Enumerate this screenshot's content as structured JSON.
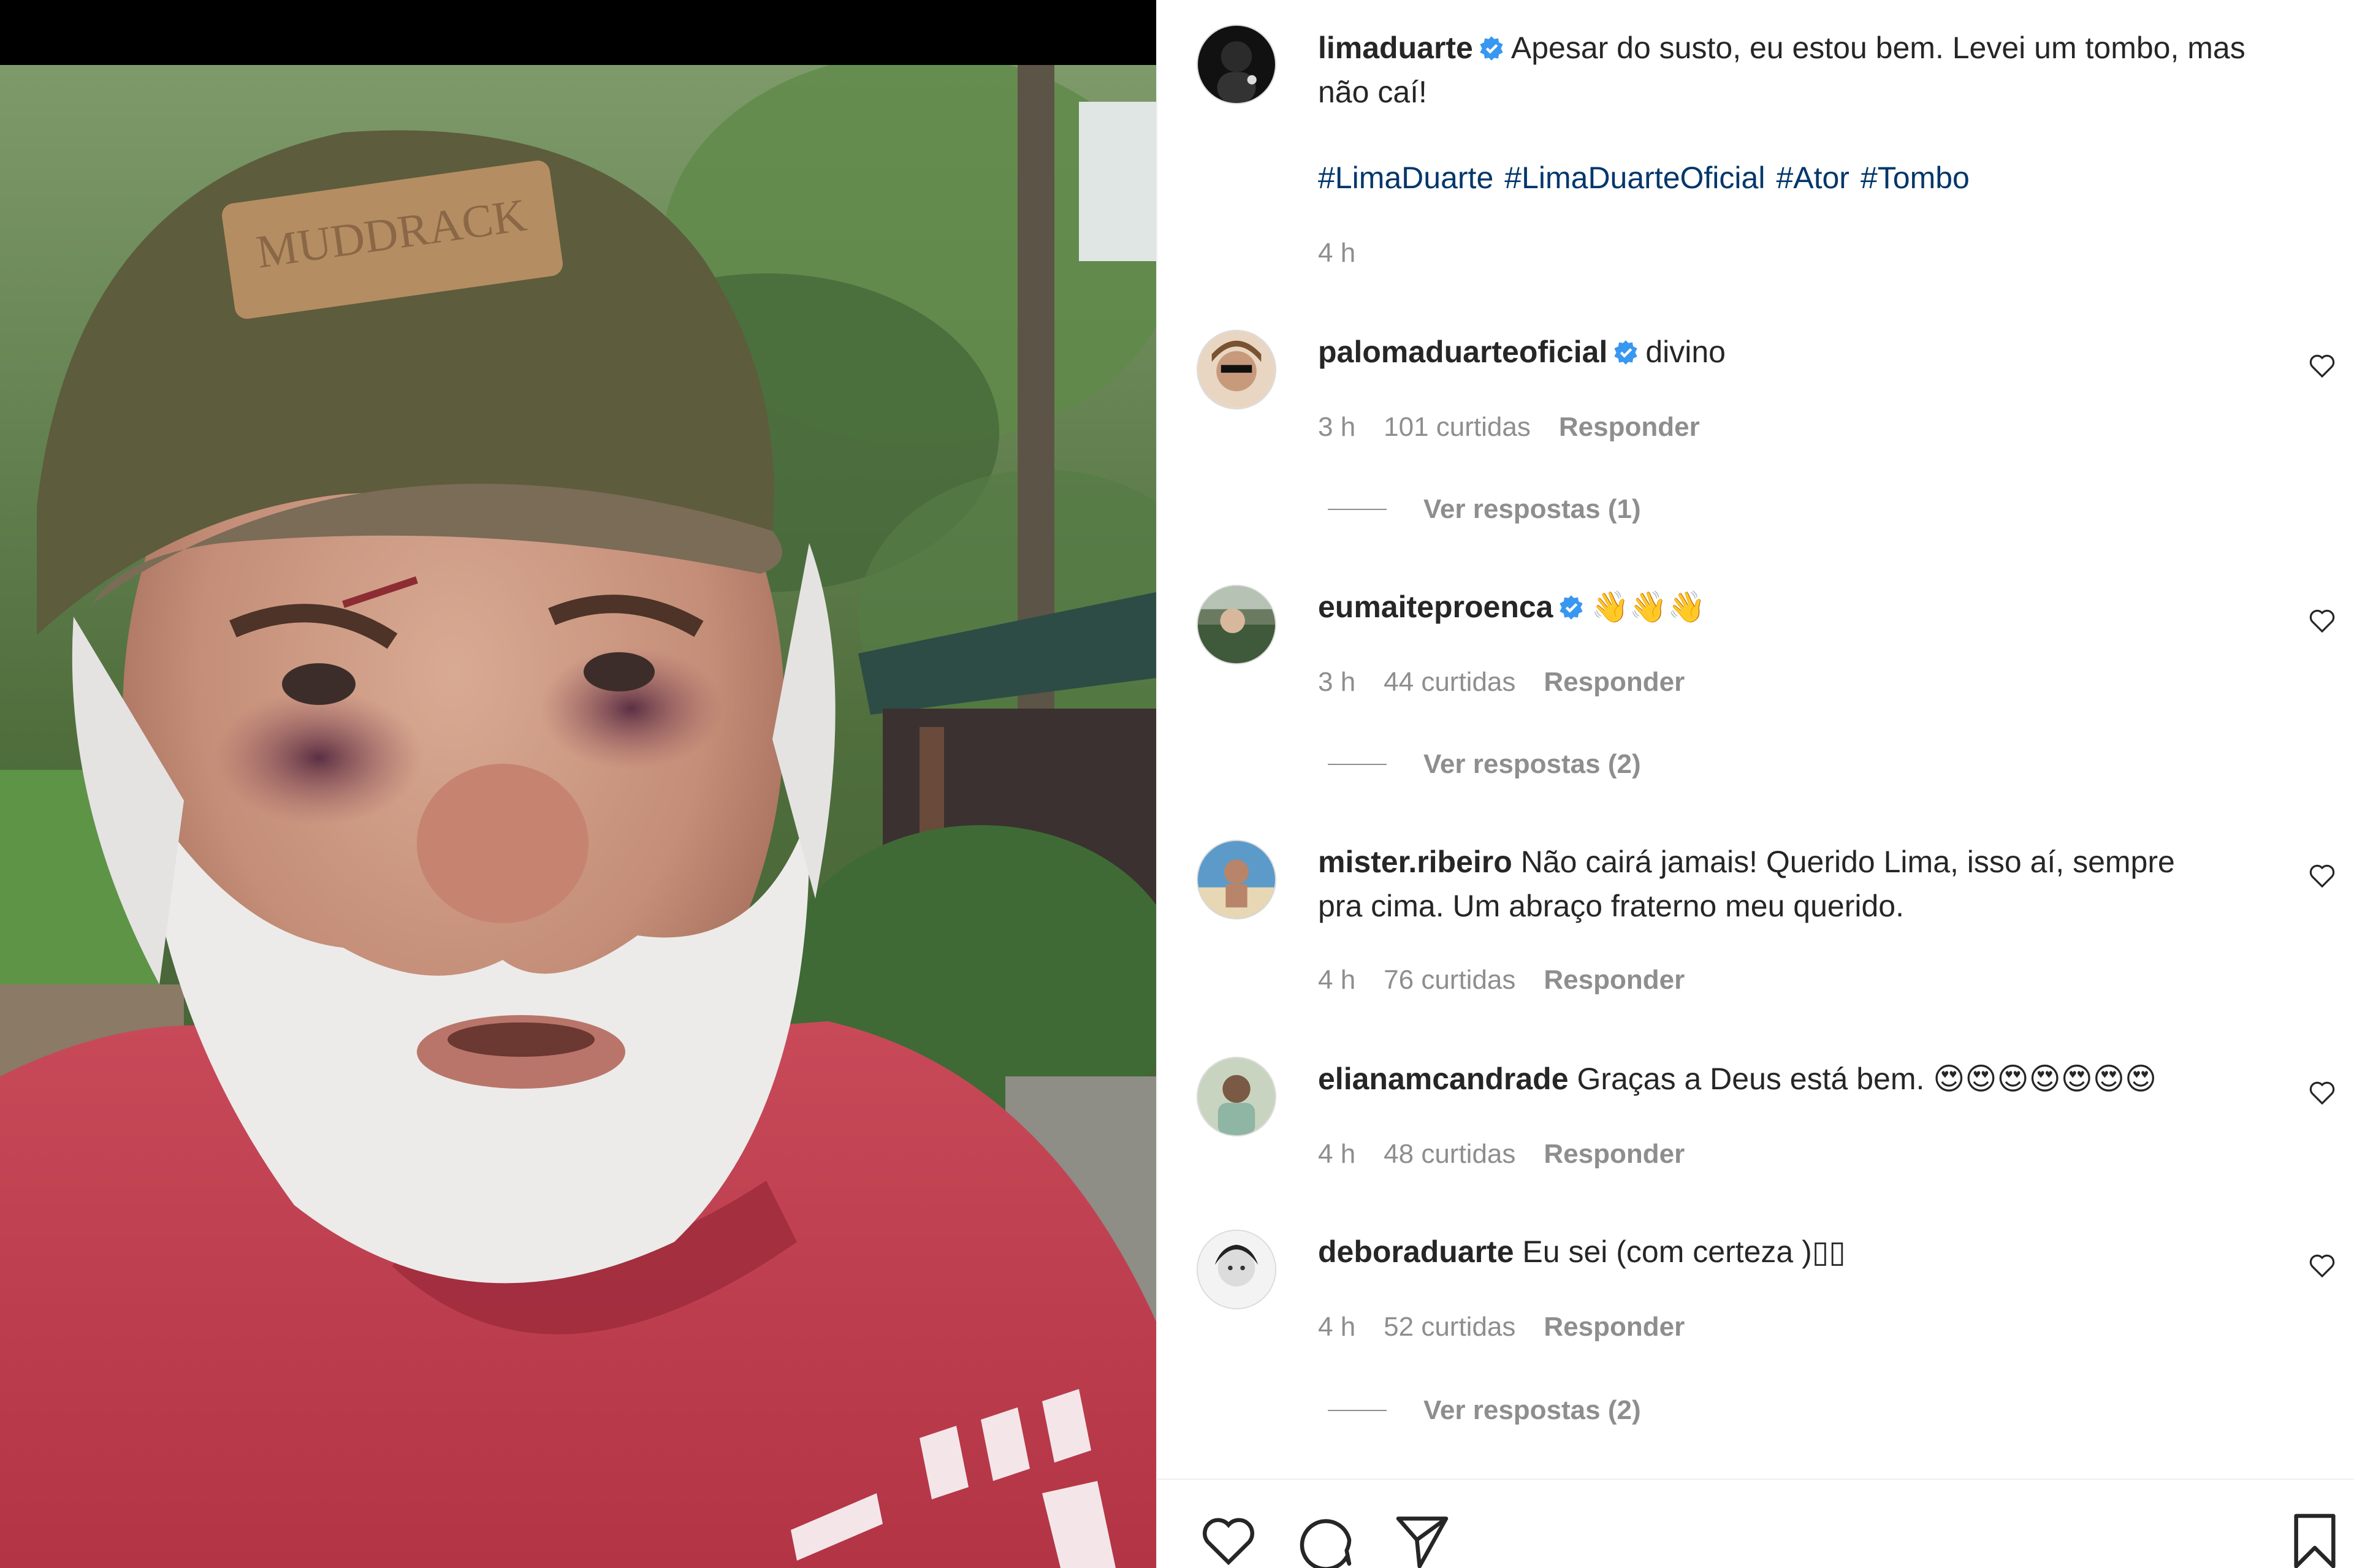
{
  "post": {
    "username": "limaduarte",
    "caption_1": "Apesar do susto, eu estou bem. Levei um tombo, mas",
    "caption_2": "não caí!",
    "hashtags": [
      "#LimaDuarte",
      "#LimaDuarteOficial",
      "#Ator",
      "#Tombo"
    ],
    "time": "4 h",
    "photo_cap_text": "MUDDRACK"
  },
  "comments": [
    {
      "username": "palomaduarteoficial",
      "verified": true,
      "text": "divino",
      "text_2": "",
      "time": "3 h",
      "likes": "101 curtidas",
      "reply": "Responder",
      "view_replies": "Ver respostas (1)"
    },
    {
      "username": "eumaiteproenca",
      "verified": true,
      "text": "👋👋👋",
      "text_2": "",
      "time": "3 h",
      "likes": "44 curtidas",
      "reply": "Responder",
      "view_replies": "Ver respostas (2)"
    },
    {
      "username": "mister.ribeiro",
      "verified": false,
      "text": "Não cairá jamais! Querido Lima, isso aí, sempre",
      "text_2": "pra cima. Um abraço fraterno meu querido.",
      "time": "4 h",
      "likes": "76 curtidas",
      "reply": "Responder",
      "view_replies": ""
    },
    {
      "username": "elianamcandrade",
      "verified": false,
      "text": "Graças a Deus está bem. 😍😍😍😍😍😍😍",
      "text_2": "",
      "time": "4 h",
      "likes": "48 curtidas",
      "reply": "Responder",
      "view_replies": ""
    },
    {
      "username": "deboraduarte",
      "verified": false,
      "text": "Eu sei (com certeza )▯▯",
      "text_2": "",
      "time": "4 h",
      "likes": "52 curtidas",
      "reply": "Responder",
      "view_replies": "Ver respostas (2)"
    }
  ],
  "icons": {
    "like": "heart-icon",
    "comment": "comment-bubble-icon",
    "share": "paper-plane-icon",
    "save": "bookmark-icon",
    "verified": "verified-badge-icon",
    "comment_like": "heart-outline-icon"
  },
  "colors": {
    "verified_blue": "#3897f0",
    "hashtag": "#00376b",
    "secondary_text": "#8e8e8e"
  }
}
